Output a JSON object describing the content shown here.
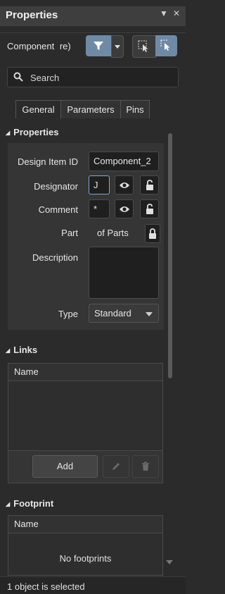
{
  "panel": {
    "title": "Properties",
    "pin_icon": "pin-icon",
    "close_icon": "close-icon"
  },
  "filter_row": {
    "label": "Component",
    "label_tail": "re)",
    "filter_button_icon": "filter-icon",
    "dropdown_icon": "chevron-down-icon",
    "select_icon_1": "select-inside-icon",
    "select_icon_2": "select-cursor-icon"
  },
  "search": {
    "placeholder": "Search",
    "value": ""
  },
  "tabs": [
    {
      "label": "General",
      "active": true
    },
    {
      "label": "Parameters",
      "active": false
    },
    {
      "label": "Pins",
      "active": false
    }
  ],
  "properties": {
    "header": "Properties",
    "design_item_id": {
      "label": "Design Item ID",
      "value": "Component_2"
    },
    "designator": {
      "label": "Designator",
      "value": "J"
    },
    "comment": {
      "label": "Comment",
      "value": "*"
    },
    "part": {
      "label": "Part",
      "value": "of Parts"
    },
    "description": {
      "label": "Description",
      "value": ""
    },
    "type": {
      "label": "Type",
      "value": "Standard"
    }
  },
  "links": {
    "header": "Links",
    "column_header": "Name",
    "add_label": "Add"
  },
  "footprint": {
    "header": "Footprint",
    "column_header": "Name",
    "empty_message": "No footprints"
  },
  "status": {
    "text": "1 object is selected"
  },
  "colors": {
    "accent": "#6f8aa6",
    "background": "#2b2b2b"
  }
}
